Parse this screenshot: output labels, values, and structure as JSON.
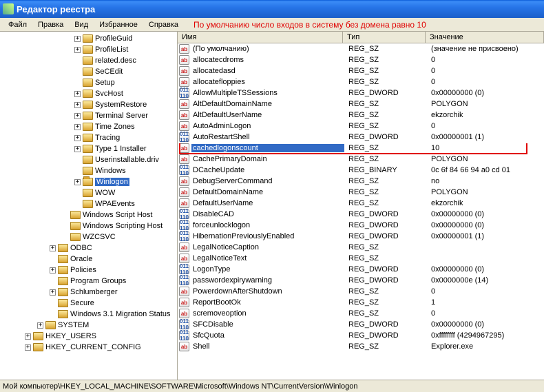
{
  "window": {
    "title": "Редактор реестра"
  },
  "menu": {
    "file": "Файл",
    "edit": "Правка",
    "view": "Вид",
    "favorites": "Избранное",
    "help": "Справка"
  },
  "annotation": "По умолчанию число входов в систему без домена равно 10",
  "tree": [
    {
      "l": 6,
      "e": "+",
      "n": "ProfileGuid"
    },
    {
      "l": 6,
      "e": "+",
      "n": "ProfileList"
    },
    {
      "l": 6,
      "e": "",
      "n": "related.desc"
    },
    {
      "l": 6,
      "e": "",
      "n": "SeCEdit"
    },
    {
      "l": 6,
      "e": "",
      "n": "Setup"
    },
    {
      "l": 6,
      "e": "+",
      "n": "SvcHost"
    },
    {
      "l": 6,
      "e": "+",
      "n": "SystemRestore"
    },
    {
      "l": 6,
      "e": "+",
      "n": "Terminal Server"
    },
    {
      "l": 6,
      "e": "+",
      "n": "Time Zones"
    },
    {
      "l": 6,
      "e": "+",
      "n": "Tracing"
    },
    {
      "l": 6,
      "e": "+",
      "n": "Type 1 Installer"
    },
    {
      "l": 6,
      "e": "",
      "n": "Userinstallable.driv"
    },
    {
      "l": 6,
      "e": "",
      "n": "Windows"
    },
    {
      "l": 6,
      "e": "+",
      "n": "Winlogon",
      "sel": true
    },
    {
      "l": 6,
      "e": "",
      "n": "WOW"
    },
    {
      "l": 6,
      "e": "",
      "n": "WPAEvents"
    },
    {
      "l": 5,
      "e": "",
      "n": "Windows Script Host"
    },
    {
      "l": 5,
      "e": "",
      "n": "Windows Scripting Host"
    },
    {
      "l": 5,
      "e": "",
      "n": "WZCSVC"
    },
    {
      "l": 4,
      "e": "+",
      "n": "ODBC"
    },
    {
      "l": 4,
      "e": "",
      "n": "Oracle"
    },
    {
      "l": 4,
      "e": "+",
      "n": "Policies"
    },
    {
      "l": 4,
      "e": "",
      "n": "Program Groups"
    },
    {
      "l": 4,
      "e": "+",
      "n": "Schlumberger"
    },
    {
      "l": 4,
      "e": "",
      "n": "Secure"
    },
    {
      "l": 4,
      "e": "",
      "n": "Windows 3.1 Migration Status"
    },
    {
      "l": 3,
      "e": "+",
      "n": "SYSTEM"
    },
    {
      "l": 2,
      "e": "+",
      "n": "HKEY_USERS"
    },
    {
      "l": 2,
      "e": "+",
      "n": "HKEY_CURRENT_CONFIG"
    }
  ],
  "listHeaders": {
    "name": "Имя",
    "type": "Тип",
    "value": "Значение"
  },
  "values": [
    {
      "i": "sz",
      "n": "(По умолчанию)",
      "t": "REG_SZ",
      "d": "(значение не присвоено)"
    },
    {
      "i": "sz",
      "n": "allocatecdroms",
      "t": "REG_SZ",
      "d": "0"
    },
    {
      "i": "sz",
      "n": "allocatedasd",
      "t": "REG_SZ",
      "d": "0"
    },
    {
      "i": "sz",
      "n": "allocatefloppies",
      "t": "REG_SZ",
      "d": "0"
    },
    {
      "i": "bin",
      "n": "AllowMultipleTSSessions",
      "t": "REG_DWORD",
      "d": "0x00000000 (0)"
    },
    {
      "i": "sz",
      "n": "AltDefaultDomainName",
      "t": "REG_SZ",
      "d": "POLYGON"
    },
    {
      "i": "sz",
      "n": "AltDefaultUserName",
      "t": "REG_SZ",
      "d": "ekzorchik"
    },
    {
      "i": "sz",
      "n": "AutoAdminLogon",
      "t": "REG_SZ",
      "d": "0"
    },
    {
      "i": "bin",
      "n": "AutoRestartShell",
      "t": "REG_DWORD",
      "d": "0x00000001 (1)"
    },
    {
      "i": "sz",
      "n": "cachedlogonscount",
      "t": "REG_SZ",
      "d": "10",
      "sel": true
    },
    {
      "i": "sz",
      "n": "CachePrimaryDomain",
      "t": "REG_SZ",
      "d": "POLYGON"
    },
    {
      "i": "bin",
      "n": "DCacheUpdate",
      "t": "REG_BINARY",
      "d": "0c 6f 84 66 94 a0 cd 01"
    },
    {
      "i": "sz",
      "n": "DebugServerCommand",
      "t": "REG_SZ",
      "d": "no"
    },
    {
      "i": "sz",
      "n": "DefaultDomainName",
      "t": "REG_SZ",
      "d": "POLYGON"
    },
    {
      "i": "sz",
      "n": "DefaultUserName",
      "t": "REG_SZ",
      "d": "ekzorchik"
    },
    {
      "i": "bin",
      "n": "DisableCAD",
      "t": "REG_DWORD",
      "d": "0x00000000 (0)"
    },
    {
      "i": "bin",
      "n": "forceunlocklogon",
      "t": "REG_DWORD",
      "d": "0x00000000 (0)"
    },
    {
      "i": "bin",
      "n": "HibernationPreviouslyEnabled",
      "t": "REG_DWORD",
      "d": "0x00000001 (1)"
    },
    {
      "i": "sz",
      "n": "LegalNoticeCaption",
      "t": "REG_SZ",
      "d": ""
    },
    {
      "i": "sz",
      "n": "LegalNoticeText",
      "t": "REG_SZ",
      "d": ""
    },
    {
      "i": "bin",
      "n": "LogonType",
      "t": "REG_DWORD",
      "d": "0x00000000 (0)"
    },
    {
      "i": "bin",
      "n": "passwordexpirywarning",
      "t": "REG_DWORD",
      "d": "0x0000000e (14)"
    },
    {
      "i": "sz",
      "n": "PowerdownAfterShutdown",
      "t": "REG_SZ",
      "d": "0"
    },
    {
      "i": "sz",
      "n": "ReportBootOk",
      "t": "REG_SZ",
      "d": "1"
    },
    {
      "i": "sz",
      "n": "scremoveoption",
      "t": "REG_SZ",
      "d": "0"
    },
    {
      "i": "bin",
      "n": "SFCDisable",
      "t": "REG_DWORD",
      "d": "0x00000000 (0)"
    },
    {
      "i": "bin",
      "n": "SfcQuota",
      "t": "REG_DWORD",
      "d": "0xffffffff (4294967295)"
    },
    {
      "i": "sz",
      "n": "Shell",
      "t": "REG_SZ",
      "d": "Explorer.exe"
    }
  ],
  "status": "Мой компьютер\\HKEY_LOCAL_MACHINE\\SOFTWARE\\Microsoft\\Windows NT\\CurrentVersion\\Winlogon"
}
